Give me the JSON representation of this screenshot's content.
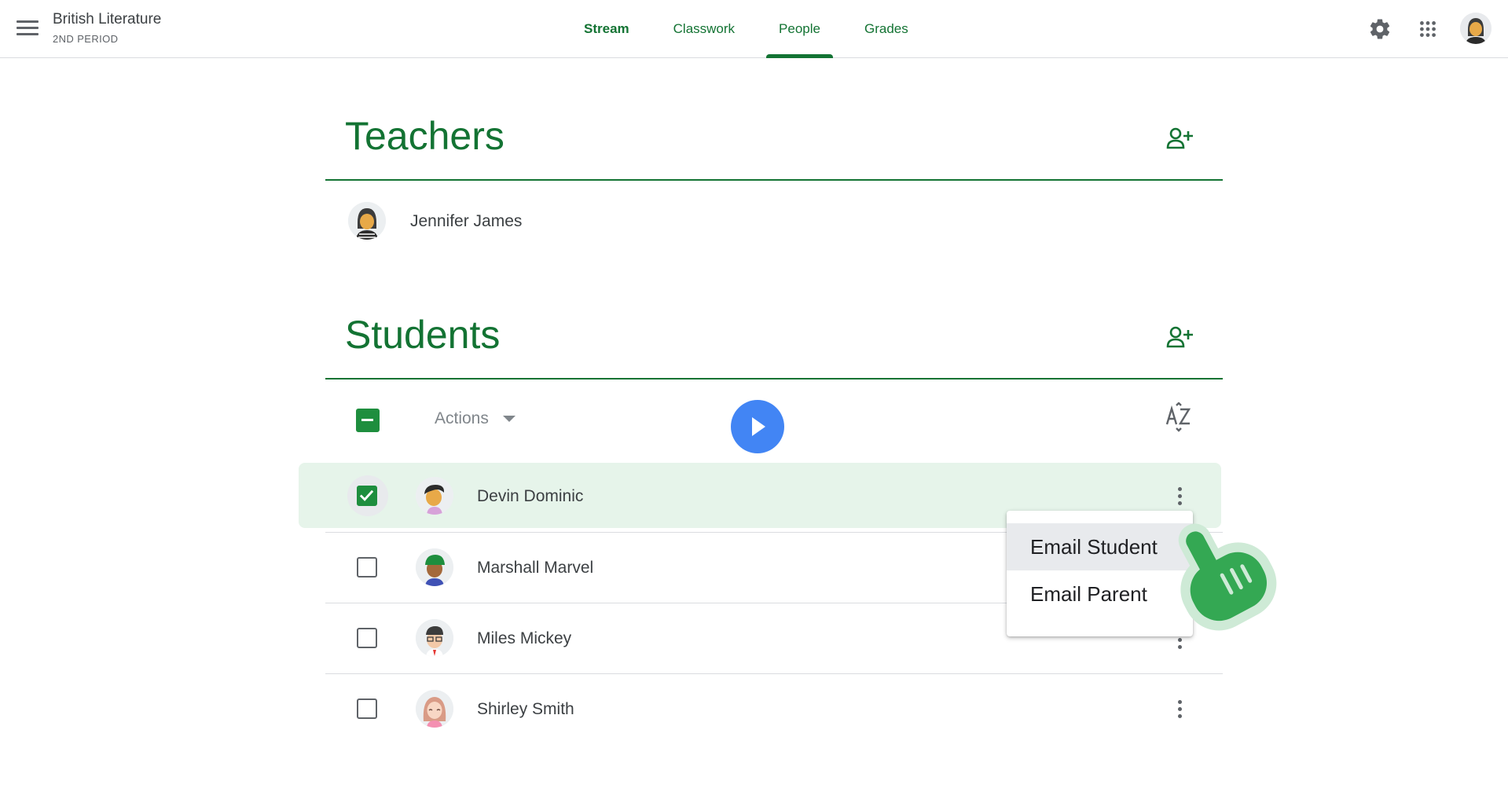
{
  "header": {
    "class_name": "British Literature",
    "class_section": "2ND PERIOD",
    "tabs": [
      {
        "label": "Stream"
      },
      {
        "label": "Classwork"
      },
      {
        "label": "People"
      },
      {
        "label": "Grades"
      }
    ],
    "active_tab": "People"
  },
  "teachers": {
    "title": "Teachers",
    "list": [
      {
        "name": "Jennifer James"
      }
    ]
  },
  "students": {
    "title": "Students",
    "actions_label": "Actions",
    "sort_icon": "sort-az-icon",
    "list": [
      {
        "name": "Devin Dominic",
        "selected": true
      },
      {
        "name": "Marshall Marvel",
        "selected": false
      },
      {
        "name": "Miles Mickey",
        "selected": false
      },
      {
        "name": "Shirley Smith",
        "selected": false
      }
    ]
  },
  "context_menu": {
    "items": [
      {
        "label": "Email Student"
      },
      {
        "label": "Email Parent"
      }
    ]
  },
  "colors": {
    "brand_green": "#137333",
    "selection_bg": "#e6f4ea",
    "play_blue": "#4285f4",
    "hand_green": "#34a853"
  }
}
